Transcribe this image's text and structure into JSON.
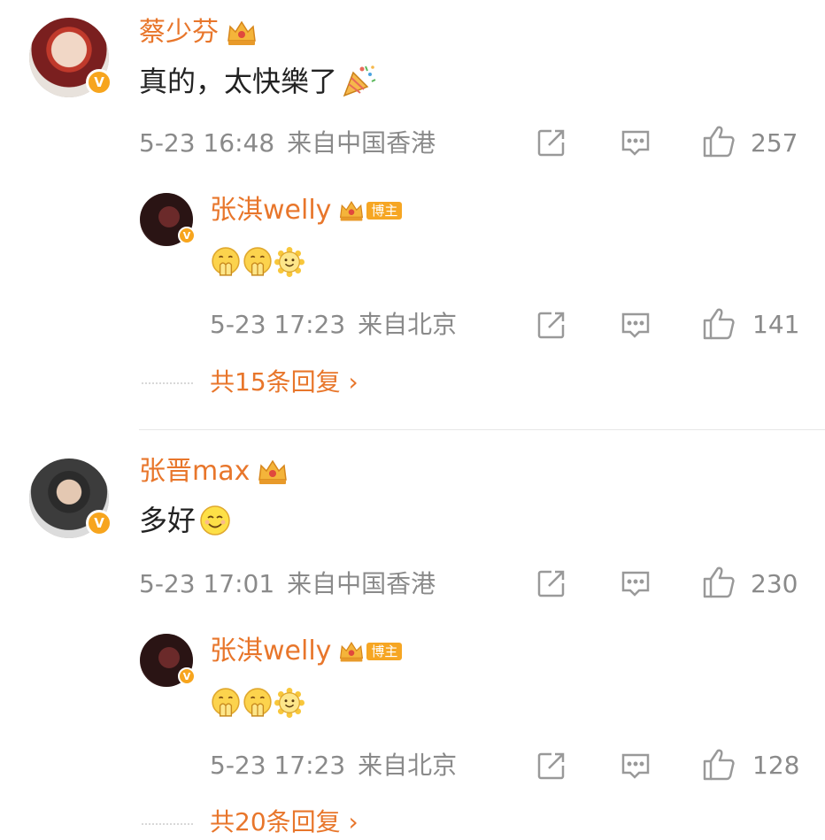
{
  "comments": [
    {
      "author": "蔡少芬",
      "verified": "V",
      "text": "真的，太快樂了",
      "emoji": "party-popper-emoji",
      "time": "5-23 16:48",
      "location": "来自中国香港",
      "likes": "257",
      "reply": {
        "author": "张淇welly",
        "badge": "博主",
        "verified": "V",
        "emojis": [
          "hands-together-emoji",
          "hands-together-emoji",
          "sun-smile-emoji"
        ],
        "time": "5-23 17:23",
        "location": "来自北京",
        "likes": "141"
      },
      "more_replies": "共15条回复 ›"
    },
    {
      "author": "张晋max",
      "verified": "V",
      "text": "多好",
      "emoji": "smile-emoji",
      "time": "5-23 17:01",
      "location": "来自中国香港",
      "likes": "230",
      "reply": {
        "author": "张淇welly",
        "badge": "博主",
        "verified": "V",
        "emojis": [
          "hands-together-emoji",
          "hands-together-emoji",
          "sun-smile-emoji"
        ],
        "time": "5-23 17:23",
        "location": "来自北京",
        "likes": "128"
      },
      "more_replies": "共20条回复 ›"
    }
  ],
  "colors": {
    "name": "#e8762b",
    "meta": "#8a8a8a",
    "badge": "#f7a51e"
  }
}
